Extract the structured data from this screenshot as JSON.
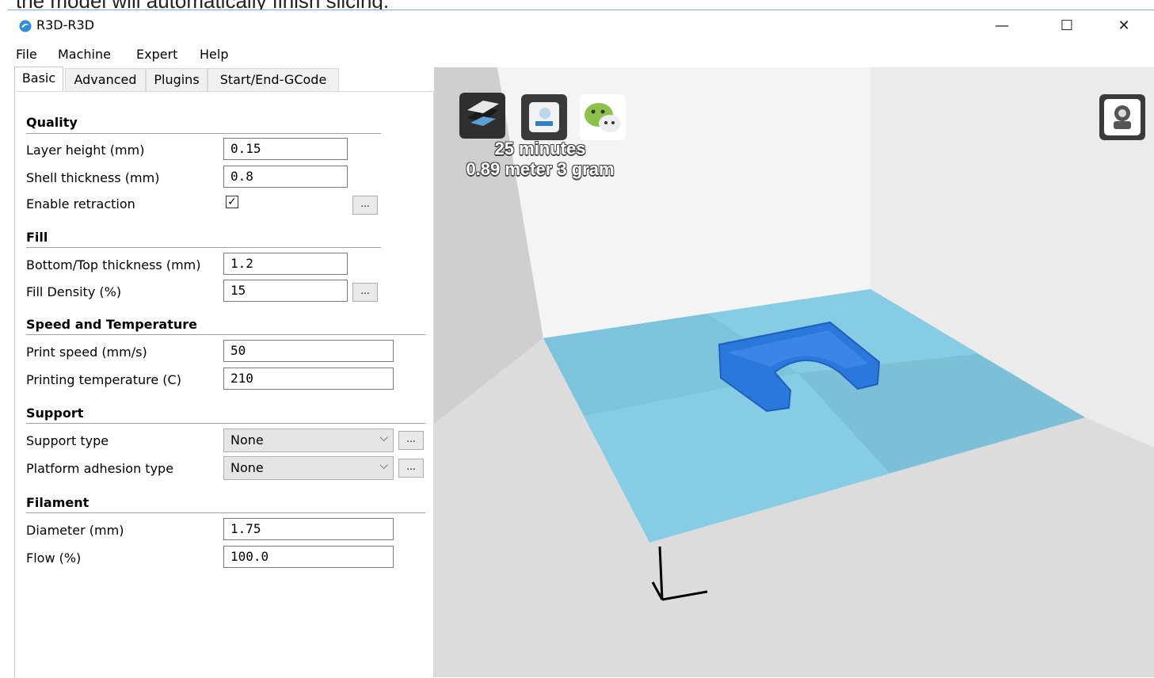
{
  "caption": "the model will automatically finish slicing.",
  "window": {
    "title": "R3D-R3D",
    "controls": {
      "minimize": "—",
      "maximize": "☐",
      "close": "✕"
    }
  },
  "menu": [
    "File",
    "Machine",
    "Expert",
    "Help"
  ],
  "tabs": [
    "Basic",
    "Advanced",
    "Plugins",
    "Start/End-GCode"
  ],
  "sections": {
    "quality": {
      "title": "Quality",
      "layer_height": {
        "label": "Layer height (mm)",
        "value": "0.15"
      },
      "shell_thickness": {
        "label": "Shell thickness (mm)",
        "value": "0.8"
      },
      "enable_retraction": {
        "label": "Enable retraction",
        "checked": true
      }
    },
    "fill": {
      "title": "Fill",
      "bottom_top": {
        "label": "Bottom/Top thickness (mm)",
        "value": "1.2"
      },
      "fill_density": {
        "label": "Fill Density (%)",
        "value": "15"
      }
    },
    "speed": {
      "title": "Speed and Temperature",
      "print_speed": {
        "label": "Print speed (mm/s)",
        "value": "50"
      },
      "print_temp": {
        "label": "Printing temperature (C)",
        "value": "210"
      }
    },
    "support": {
      "title": "Support",
      "support_type": {
        "label": "Support type",
        "value": "None"
      },
      "adhesion": {
        "label": "Platform adhesion type",
        "value": "None"
      }
    },
    "filament": {
      "title": "Filament",
      "diameter": {
        "label": "Diameter (mm)",
        "value": "1.75"
      },
      "flow": {
        "label": "Flow (%)",
        "value": "100.0"
      }
    }
  },
  "ellipsis": "...",
  "viewport": {
    "print_time": "25 minutes",
    "material": "0.89 meter 3 gram",
    "icons": [
      "load-icon",
      "save-to-sd-icon",
      "wechat-icon",
      "view-mode-icon"
    ],
    "colors": {
      "bed": "#86cce4",
      "model": "#2b78dd",
      "background": "#dcdcdc"
    }
  }
}
